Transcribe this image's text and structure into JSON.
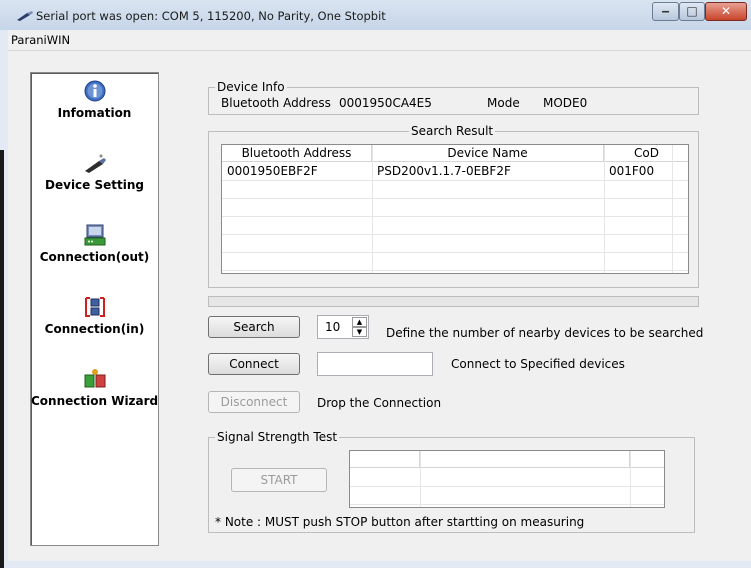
{
  "window": {
    "title": "Serial port was open: COM 5, 115200, No Parity, One Stopbit",
    "menu": [
      "ParaniWIN"
    ],
    "controls": {
      "minimize": "‒",
      "maximize": "□",
      "close": "✕"
    }
  },
  "sidebar": {
    "items": [
      {
        "label": "Infomation",
        "icon": "info-icon"
      },
      {
        "label": "Device Setting",
        "icon": "device-setting-icon"
      },
      {
        "label": "Connection(out)",
        "icon": "connection-out-icon"
      },
      {
        "label": "Connection(in)",
        "icon": "connection-in-icon"
      },
      {
        "label": "Connection Wizard",
        "icon": "connection-wizard-icon"
      }
    ]
  },
  "device_info": {
    "group_title": "Device Info",
    "bt_address_label": "Bluetooth Address",
    "bt_address_value": "0001950CA4E5",
    "mode_label": "Mode",
    "mode_value": "MODE0"
  },
  "search_result": {
    "group_title": "Search Result",
    "columns": [
      "Bluetooth Address",
      "Device Name",
      "CoD"
    ],
    "rows": [
      {
        "address": "0001950EBF2F",
        "name": "PSD200v1.1.7-0EBF2F",
        "cod": "001F00"
      }
    ]
  },
  "search": {
    "button_label": "Search",
    "count_value": "10",
    "description": "Define the number of nearby devices to be searched"
  },
  "connect": {
    "button_label": "Connect",
    "input_value": "",
    "description": "Connect to Specified devices"
  },
  "disconnect": {
    "button_label": "Disconnect",
    "description": "Drop the Connection"
  },
  "signal_test": {
    "group_title": "Signal Strength Test",
    "start_label": "START",
    "note": "* Note : MUST push STOP button after startting on measuring"
  },
  "colors": {
    "title_bar": "#c6d5e8",
    "close_button": "#c8442b",
    "client_bg": "#f0f0f0"
  }
}
